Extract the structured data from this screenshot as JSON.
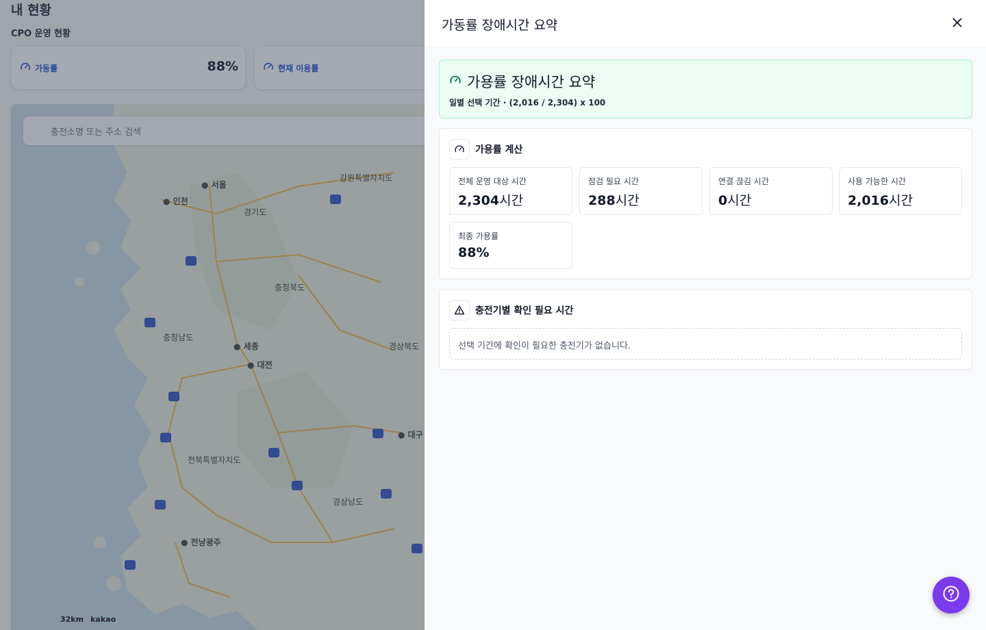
{
  "background": {
    "title": "내 현황",
    "subtitle": "CPO 운영 현황",
    "cards": [
      {
        "label": "가동률",
        "value": "88%"
      },
      {
        "label": "현재 이용률",
        "value": ""
      }
    ],
    "map": {
      "search_placeholder": "충전소명 또는 주소 검색",
      "scale": "32km",
      "brand": "kakao",
      "places": [
        "서울",
        "인천",
        "강원특별자치도",
        "경기도",
        "충청북도",
        "충청남도",
        "세종",
        "대전",
        "경상북도",
        "대구",
        "전북특별자치도",
        "경상남도",
        "전남광주"
      ]
    }
  },
  "drawer": {
    "title": "가동률 장애시간 요약",
    "close_icon": "close-icon",
    "summary": {
      "title": "가용률 장애시간 요약",
      "formula": "일별 선택 기간 · (2,016 / 2,304) x 100"
    },
    "calc": {
      "heading": "가용률 계산",
      "metrics": [
        {
          "label": "전체 운영 대상 시간",
          "value": "2,304",
          "unit": "시간"
        },
        {
          "label": "점검 필요 시간",
          "value": "288",
          "unit": "시간"
        },
        {
          "label": "연결 끊김 시간",
          "value": "0",
          "unit": "시간"
        },
        {
          "label": "사용 가능한 시간",
          "value": "2,016",
          "unit": "시간"
        },
        {
          "label": "최종 가용률",
          "value": "88%",
          "unit": ""
        }
      ]
    },
    "chargers": {
      "heading": "충전기별 확인 필요 시간",
      "empty_text": "선택 기간에 확인이 필요한 충전기가 없습니다."
    }
  },
  "colors": {
    "accent_green_bg": "#ecfdf3",
    "help_button": "#7c3aed",
    "overlay": "#374151"
  }
}
